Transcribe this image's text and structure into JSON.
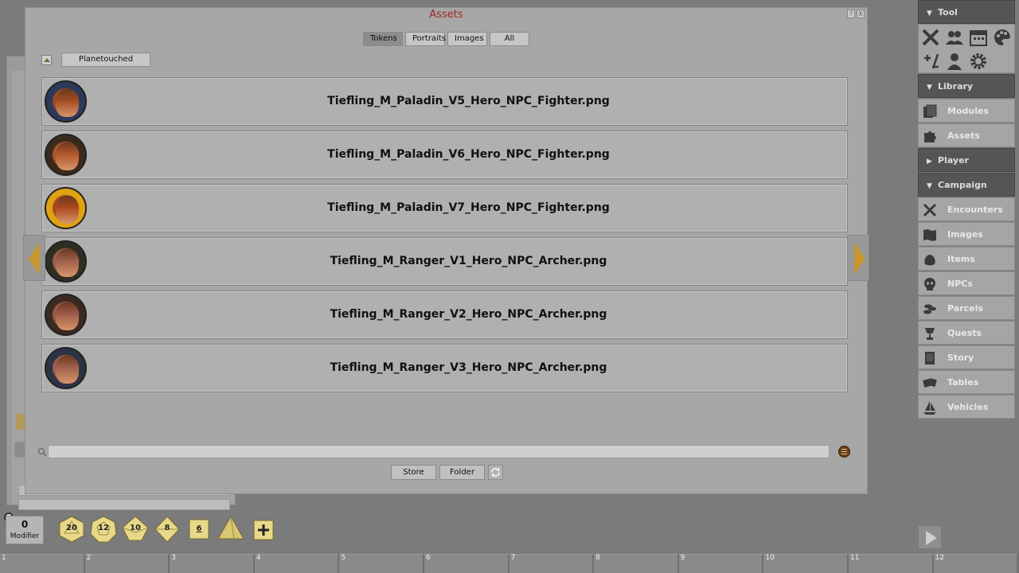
{
  "window": {
    "title": "Assets",
    "help_btn": "?",
    "close_btn": "X"
  },
  "filters": {
    "tokens": "Tokens",
    "portraits": "Portraits",
    "images": "Images",
    "all": "All",
    "active": "Tokens"
  },
  "folder": {
    "current": "Planetouched"
  },
  "assets": [
    {
      "name": "Tiefling_M_Paladin_V5_Hero_NPC_Fighter.png",
      "ring": "#2b3a5a",
      "face": "#a04a22"
    },
    {
      "name": "Tiefling_M_Paladin_V6_Hero_NPC_Fighter.png",
      "ring": "#3a2a1c",
      "face": "#b0552a"
    },
    {
      "name": "Tiefling_M_Paladin_V7_Hero_NPC_Fighter.png",
      "ring": "#e0a20f",
      "face": "#a8461f"
    },
    {
      "name": "Tiefling_M_Ranger_V1_Hero_NPC_Archer.png",
      "ring": "#2e2e24",
      "face": "#9d5d4a"
    },
    {
      "name": "Tiefling_M_Ranger_V2_Hero_NPC_Archer.png",
      "ring": "#3a2a22",
      "face": "#9b5a48"
    },
    {
      "name": "Tiefling_M_Ranger_V3_Hero_NPC_Archer.png",
      "ring": "#2b3344",
      "face": "#9d5f4c"
    }
  ],
  "search": {
    "value": "",
    "placeholder": ""
  },
  "buttons": {
    "store": "Store",
    "folder": "Folder"
  },
  "sidebar": {
    "tool_header": "Tool",
    "library_header": "Library",
    "library_items": [
      "Modules",
      "Assets"
    ],
    "player_header": "Player",
    "campaign_header": "Campaign",
    "campaign_items": [
      "Encounters",
      "Images",
      "Items",
      "NPCs",
      "Parcels",
      "Quests",
      "Story",
      "Tables",
      "Vehicles"
    ]
  },
  "modifier": {
    "value": "0",
    "label": "Modifier"
  },
  "dice": [
    "20",
    "12",
    "10",
    "8",
    "6"
  ],
  "hotbar": [
    "1",
    "2",
    "3",
    "4",
    "5",
    "6",
    "7",
    "8",
    "9",
    "10",
    "11",
    "12"
  ],
  "colors": {
    "title": "#a3231f",
    "arrow_gold": "#c8972e",
    "dice_gold": "#e8d98a"
  }
}
